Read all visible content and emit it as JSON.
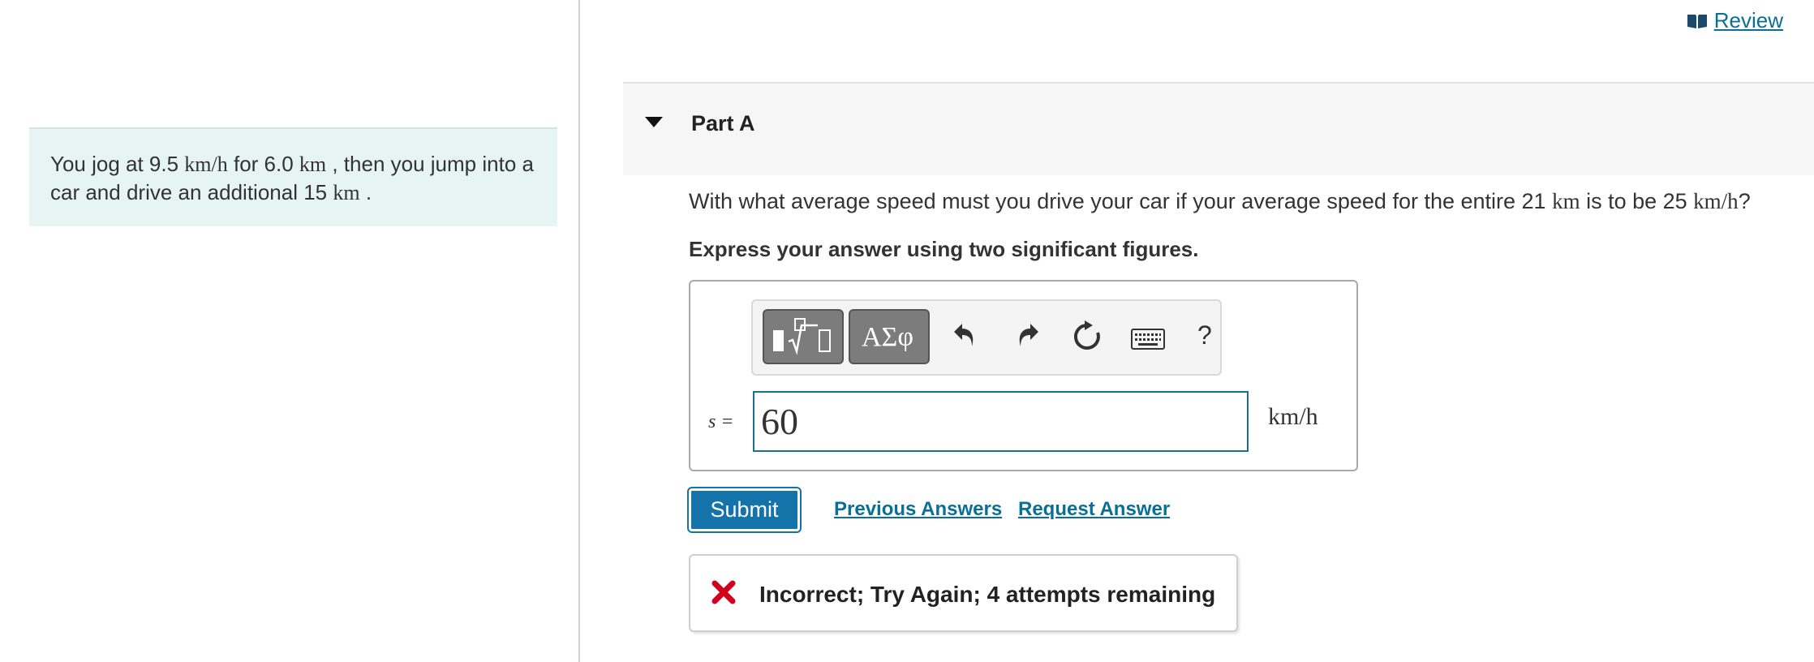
{
  "review": {
    "label": "Review",
    "icon": "book-icon"
  },
  "problem": {
    "text_1": "You jog at 9.5 ",
    "unit_1": "km/h",
    "text_2": " for 6.0 ",
    "unit_2": "km",
    "text_3": " , then you jump into a car and drive an additional 15 ",
    "unit_3": "km",
    "text_4": " ."
  },
  "part": {
    "title": "Part A",
    "toggle_icon": "caret-down-icon"
  },
  "question": {
    "text_1": "With what average speed must you drive your car if your average speed for the entire 21 ",
    "unit_1": "km",
    "text_2": " is to be 25 ",
    "unit_2": "km/h",
    "text_3": "?"
  },
  "instruction": "Express your answer using two significant figures.",
  "toolbar": {
    "buttons": [
      "templates-icon",
      "greek-symbols-icon",
      "undo-icon",
      "redo-icon",
      "reset-icon",
      "keyboard-icon",
      "help-icon"
    ],
    "symbols_label": "ΑΣφ",
    "help_label": "?"
  },
  "answer": {
    "variable": "s =",
    "value": "60",
    "unit": "km/h"
  },
  "actions": {
    "submit": "Submit",
    "previous_answers": "Previous Answers",
    "request_answer": "Request Answer"
  },
  "feedback": {
    "text": "Incorrect; Try Again; 4 attempts remaining",
    "icon": "x-icon",
    "color": "#d0021b"
  },
  "colors": {
    "accent": "#1473a8",
    "link": "#0a6f97",
    "problem_bg": "#e6f4f3"
  }
}
